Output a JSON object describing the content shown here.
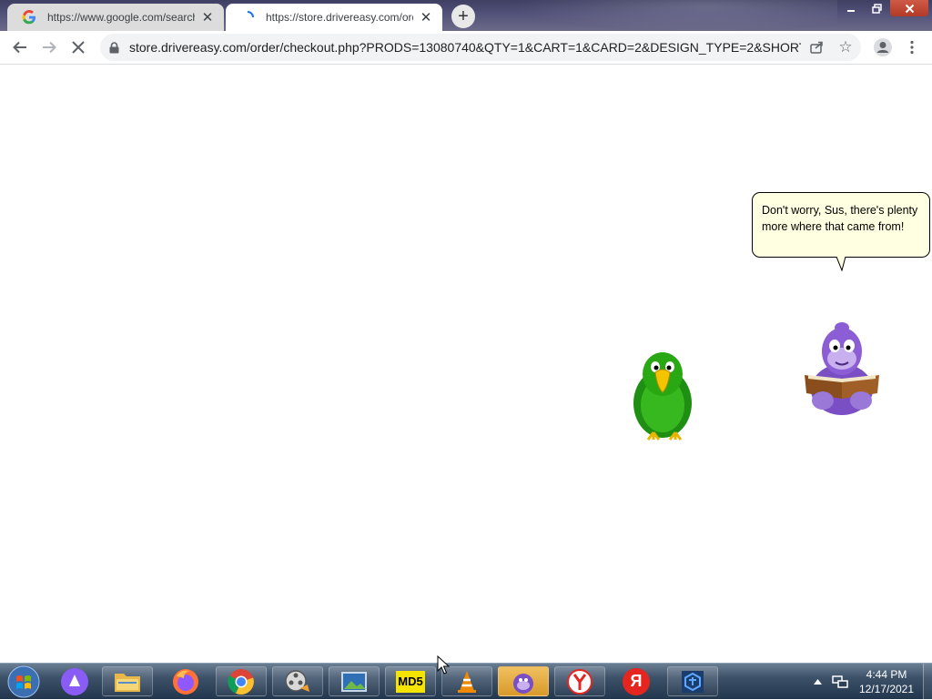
{
  "browser": {
    "tabs": [
      {
        "title": "https://www.google.com/search?",
        "favicon": "google-g-icon",
        "active": false
      },
      {
        "title": "https://store.drivereasy.com/order",
        "favicon": "loading-spinner-icon",
        "active": true
      }
    ],
    "address_bar": {
      "url": "store.drivereasy.com/order/checkout.php?PRODS=13080740&QTY=1&CART=1&CARD=2&DESIGN_TYPE=2&SHORT_..."
    },
    "state": "loading"
  },
  "assistant": {
    "speech": "Don't worry, Sus, there's plenty more where that came from!"
  },
  "taskbar": {
    "apps": [
      "windows-start",
      "alice-assistant",
      "file-explorer",
      "firefox",
      "chrome",
      "movie-maker",
      "photo-viewer",
      "md5-tool",
      "vlc",
      "bonzibuddy",
      "yandex-browser",
      "yandex",
      "app-cube"
    ],
    "md5_label": "MD5",
    "yandex_letter": "Я",
    "clock_time": "4:44 PM",
    "clock_date": "12/17/2021"
  },
  "colors": {
    "tab_active": "#ffffff",
    "tab_inactive": "#dcdcdc",
    "bubble_bg": "#ffffe1",
    "taskbar": "#2c4158"
  }
}
